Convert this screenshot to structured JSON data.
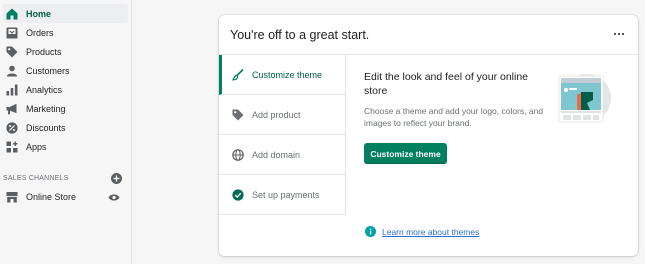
{
  "sidebar": {
    "items": [
      {
        "label": "Home",
        "icon": "home-icon",
        "active": true
      },
      {
        "label": "Orders",
        "icon": "orders-icon"
      },
      {
        "label": "Products",
        "icon": "tag-icon"
      },
      {
        "label": "Customers",
        "icon": "person-icon"
      },
      {
        "label": "Analytics",
        "icon": "bar-chart-icon"
      },
      {
        "label": "Marketing",
        "icon": "megaphone-icon"
      },
      {
        "label": "Discounts",
        "icon": "discount-icon"
      },
      {
        "label": "Apps",
        "icon": "apps-icon"
      }
    ],
    "sales_channels": {
      "heading": "SALES CHANNELS",
      "items": [
        {
          "label": "Online Store",
          "icon": "store-icon"
        }
      ]
    }
  },
  "card": {
    "title": "You're off to a great start.",
    "steps": [
      {
        "label": "Customize theme",
        "icon": "brush-icon",
        "active": true
      },
      {
        "label": "Add product",
        "icon": "tag-icon"
      },
      {
        "label": "Add domain",
        "icon": "globe-icon"
      },
      {
        "label": "Set up payments",
        "icon": "check-circle-icon"
      }
    ],
    "content": {
      "heading": "Edit the look and feel of your online store",
      "body": "Choose a theme and add your logo, colors, and images to reflect your brand.",
      "button_label": "Customize theme",
      "learn_more": "Learn more about themes"
    }
  },
  "colors": {
    "accent": "#008060",
    "active_text": "#005e46",
    "link": "#2c6ecb"
  }
}
